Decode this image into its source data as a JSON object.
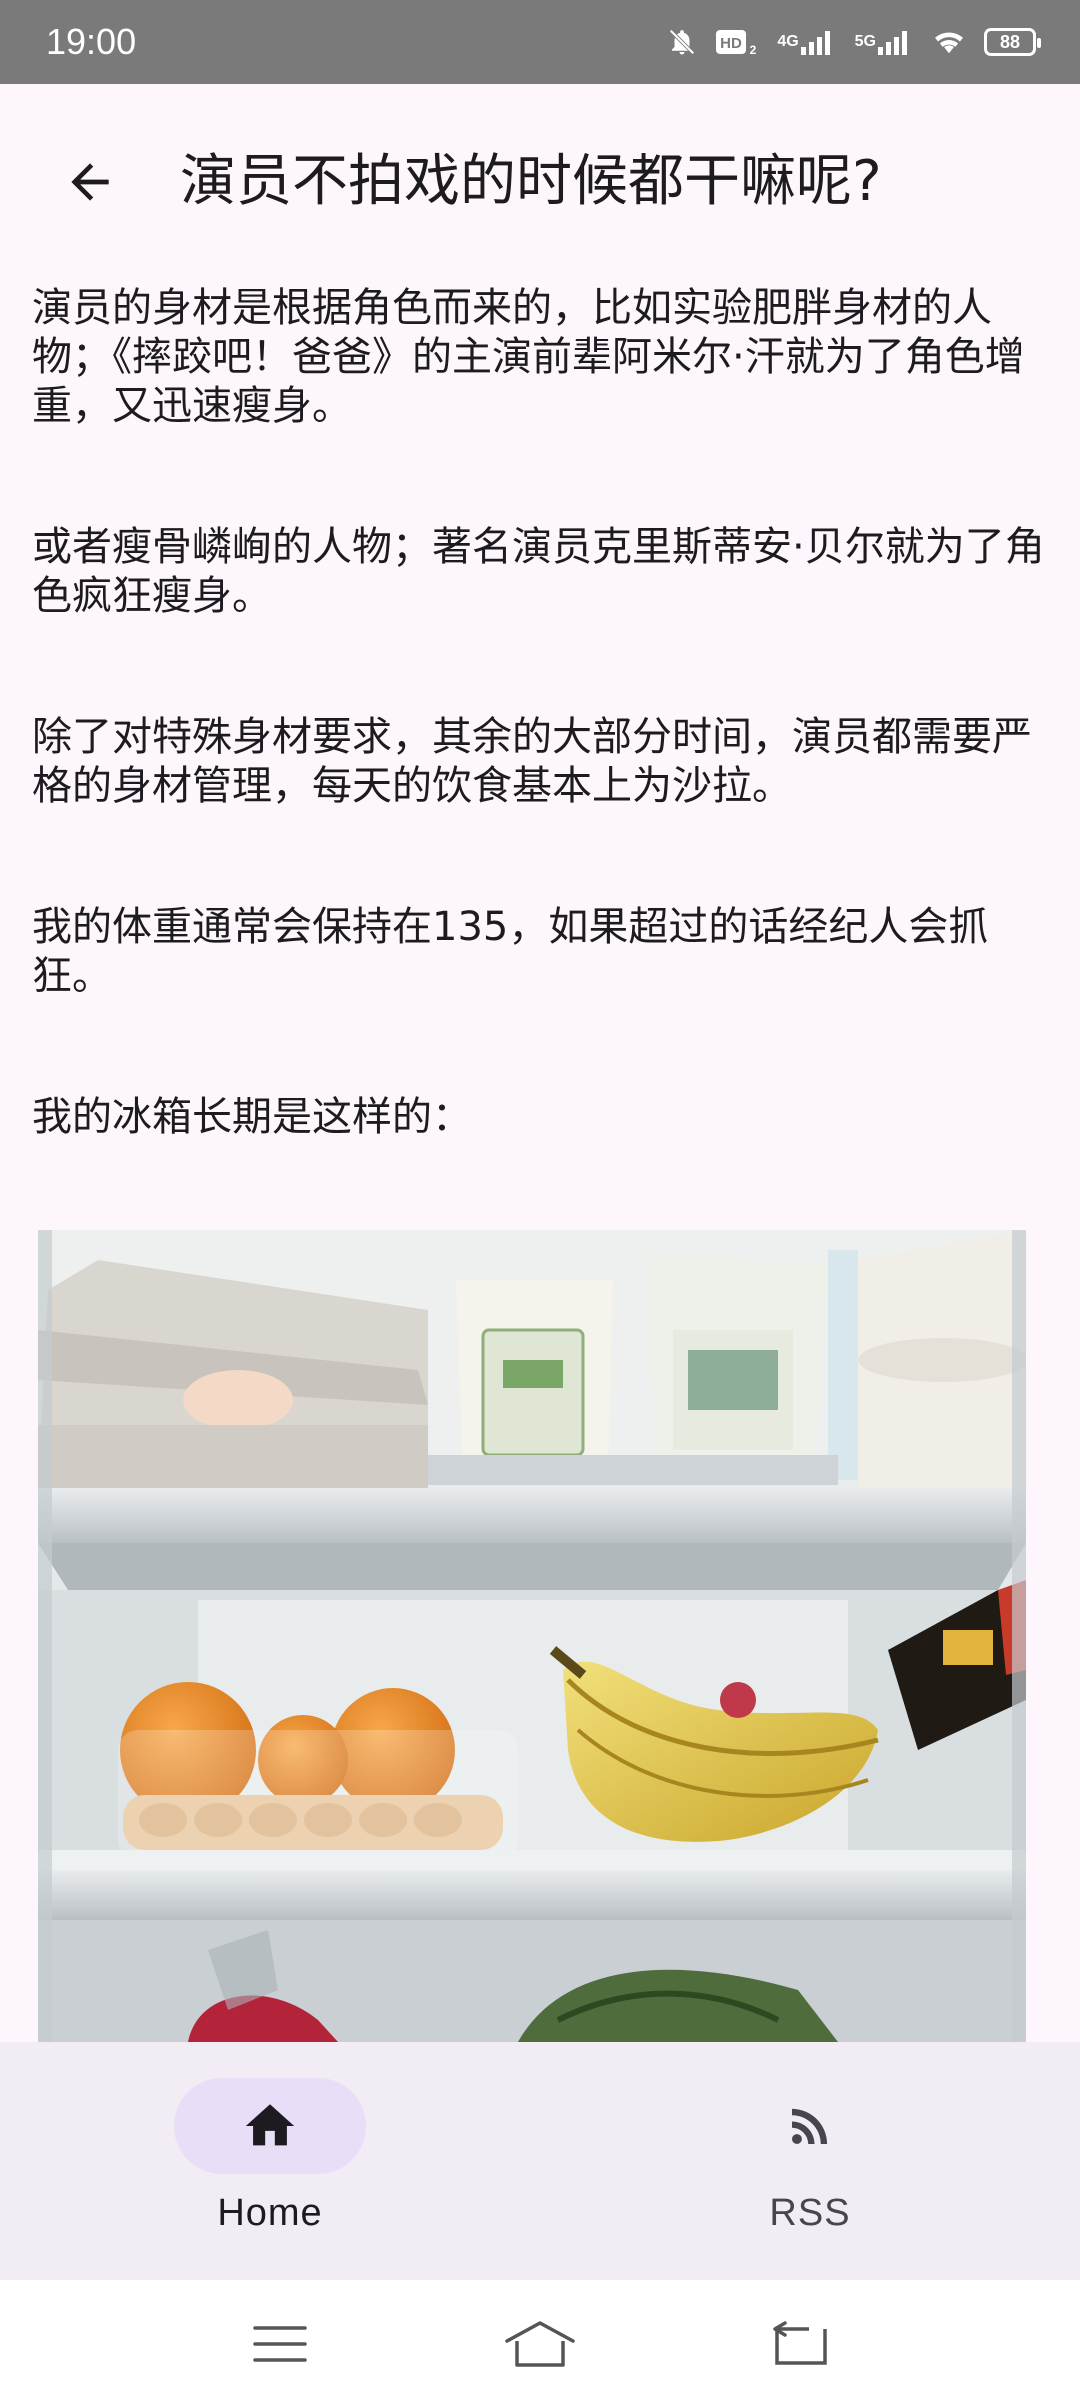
{
  "status_bar": {
    "time": "19:00",
    "network_4g": "4G",
    "network_5g": "5G",
    "battery": "88",
    "icons": [
      "mute-bell-icon",
      "hd-icon",
      "signal-4g-icon",
      "signal-5g-icon",
      "wifi-icon",
      "battery-icon"
    ]
  },
  "app_bar": {
    "title": "演员不拍戏的时候都干嘛呢?",
    "back_icon": "arrow-back-icon"
  },
  "article": {
    "paragraphs": [
      "演员的身材是根据角色而来的，比如实验肥胖身材的人物；《摔跤吧！爸爸》的主演前辈阿米尔·汗就为了角色增重，又迅速瘦身。",
      "或者瘦骨嶙峋的人物；著名演员克里斯蒂安·贝尔就为了角色疯狂瘦身。",
      "除了对特殊身材要求，其余的大部分时间，演员都需要严格的身材管理，每天的饮食基本上为沙拉。",
      "我的体重通常会保持在135，如果超过的话经纪人会抓狂。",
      "我的冰箱长期是这样的："
    ],
    "image_label": "fridge-photo"
  },
  "bottom_nav": {
    "items": [
      {
        "label": "Home",
        "icon": "home-icon",
        "active": true
      },
      {
        "label": "RSS",
        "icon": "rss-icon",
        "active": false
      }
    ]
  },
  "system_nav": {
    "icons": [
      "menu-icon",
      "home-outline-icon",
      "back-return-icon"
    ]
  },
  "colors": {
    "background": "#fdf7fd",
    "status_bar": "#7a7a7a",
    "nav_background": "#f2ecf4",
    "active_indicator": "#e8def8"
  }
}
